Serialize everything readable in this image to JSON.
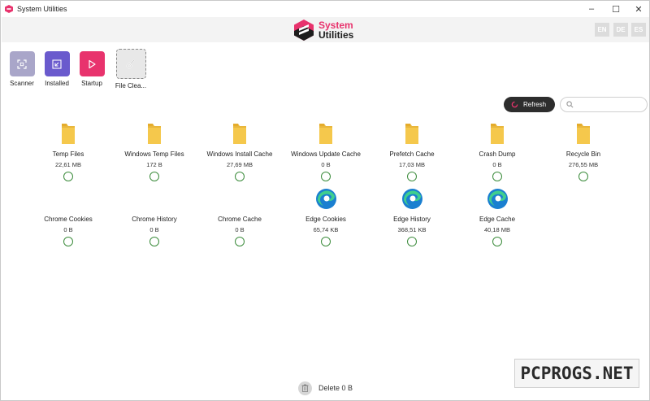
{
  "window": {
    "title": "System Utilities",
    "minimize": "–",
    "maximize": "☐",
    "close": "✕"
  },
  "header": {
    "logo_line1": "System",
    "logo_line2": "Utilities",
    "languages": [
      "EN",
      "DE",
      "ES"
    ]
  },
  "nav": [
    {
      "label": "Scanner",
      "icon": "scan-icon",
      "color": "#a9a6c9"
    },
    {
      "label": "Installed",
      "icon": "installed-icon",
      "color": "#6a5acd"
    },
    {
      "label": "Startup",
      "icon": "play-icon",
      "color": "#e8336d"
    },
    {
      "label": "File Clea...",
      "icon": "broom-icon",
      "color": "#e8e8e8"
    }
  ],
  "toolbar": {
    "refresh_label": "Refresh",
    "search_placeholder": ""
  },
  "items": [
    {
      "name": "Temp Files",
      "size": "22,61 MB",
      "icon": "folder-icon"
    },
    {
      "name": "Windows Temp Files",
      "size": "172 B",
      "icon": "folder-icon"
    },
    {
      "name": "Windows Install Cache",
      "size": "27,69 MB",
      "icon": "folder-icon"
    },
    {
      "name": "Windows Update Cache",
      "size": "0 B",
      "icon": "folder-icon"
    },
    {
      "name": "Prefetch Cache",
      "size": "17,03 MB",
      "icon": "folder-icon"
    },
    {
      "name": "Crash Dump",
      "size": "0 B",
      "icon": "folder-icon"
    },
    {
      "name": "Recycle Bin",
      "size": "276,55 MB",
      "icon": "folder-icon"
    },
    {
      "name": "Chrome Cookies",
      "size": "0 B",
      "icon": "none"
    },
    {
      "name": "Chrome History",
      "size": "0 B",
      "icon": "none"
    },
    {
      "name": "Chrome Cache",
      "size": "0 B",
      "icon": "none"
    },
    {
      "name": "Edge Cookies",
      "size": "65,74 KB",
      "icon": "edge-icon"
    },
    {
      "name": "Edge History",
      "size": "368,51 KB",
      "icon": "edge-icon"
    },
    {
      "name": "Edge Cache",
      "size": "40,18 MB",
      "icon": "edge-icon"
    }
  ],
  "footer": {
    "delete_label": "Delete 0 B"
  },
  "watermark": "PCPROGS.NET",
  "colors": {
    "accent": "#e8336d",
    "dark": "#2d2d2d",
    "check": "#3c8c3c",
    "folder": "#f5c84c"
  }
}
